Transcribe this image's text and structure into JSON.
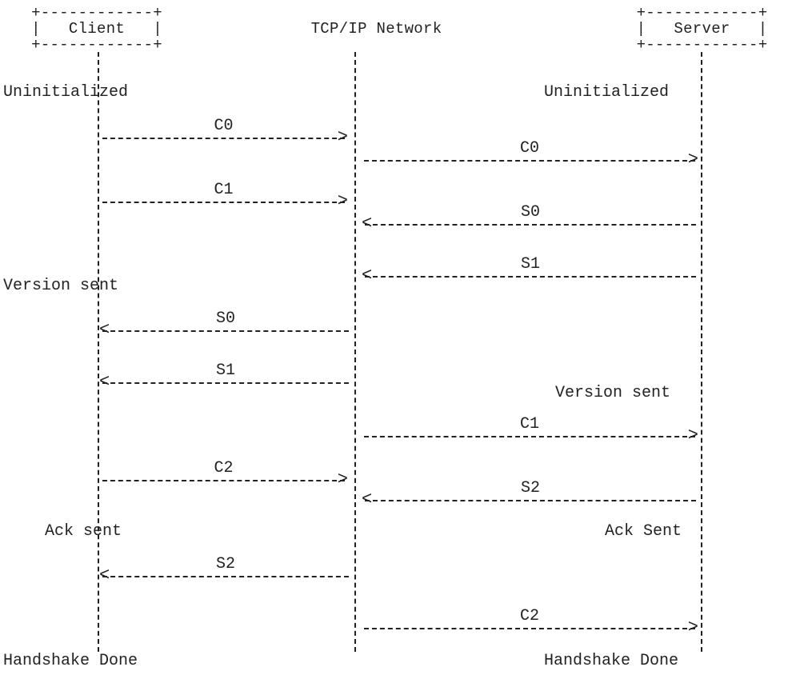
{
  "headers": {
    "client": "Client",
    "network": "TCP/IP Network",
    "server": "Server"
  },
  "ascii": {
    "top": "+------------+",
    "mid_l": "|            |",
    "mid_r": "|            |",
    "bottom": "+------------+"
  },
  "states": {
    "client_uninitialized": "Uninitialized",
    "server_uninitialized": "Uninitialized",
    "client_version_sent": "Version sent",
    "server_version_sent": "Version sent",
    "client_ack_sent": "Ack sent",
    "server_ack_sent": "Ack Sent",
    "client_handshake_done": "Handshake Done",
    "server_handshake_done": "Handshake Done"
  },
  "messages": {
    "c0_a": "C0",
    "c0_b": "C0",
    "c1_a": "C1",
    "s0_b": "S0",
    "s1_b": "S1",
    "s0_a": "S0",
    "s1_a": "S1",
    "c1_b": "C1",
    "c2_a": "C2",
    "s2_b": "S2",
    "s2_a": "S2",
    "c2_b": "C2"
  },
  "glyphs": {
    "right": ">",
    "left": "<"
  }
}
